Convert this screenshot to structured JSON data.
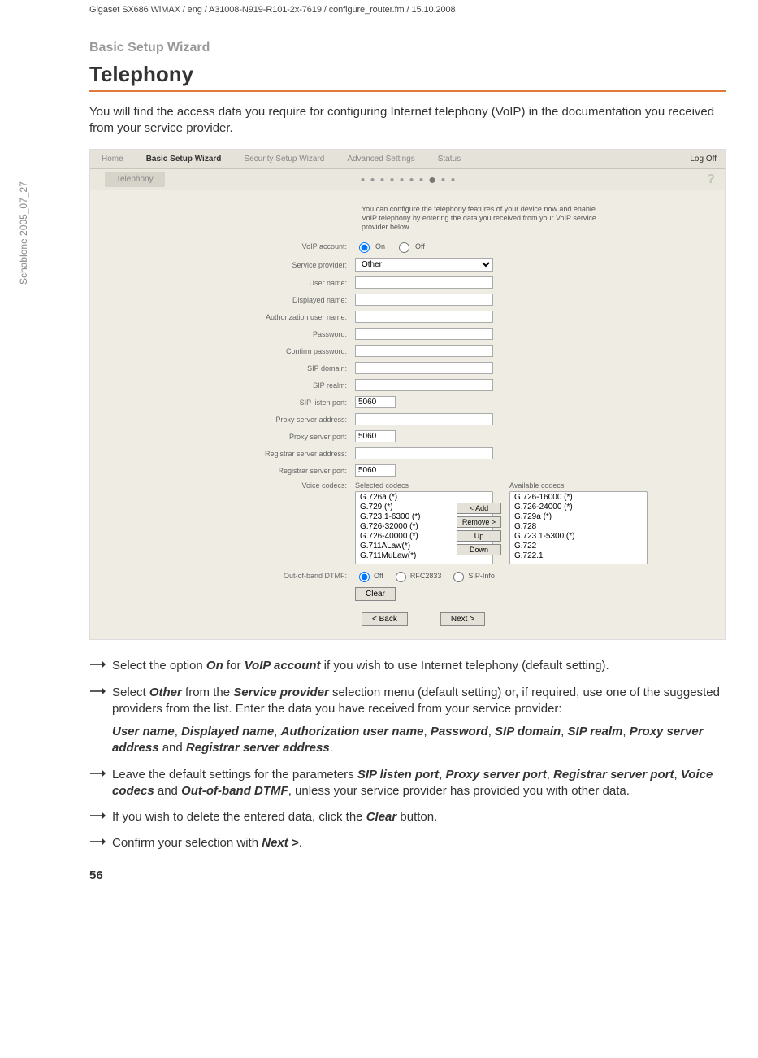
{
  "header_line": "Gigaset SX686 WiMAX / eng / A31008-N919-R101-2x-7619 / configure_router.fm / 15.10.2008",
  "side_label": "Schablone 2005_07_27",
  "section_label": "Basic Setup Wizard",
  "title": "Telephony",
  "intro": "You will find the access data you require for configuring Internet telephony (VoIP) in the documentation you received from your service provider.",
  "page_number": "56",
  "screenshot": {
    "tabs": {
      "home": "Home",
      "basic": "Basic Setup Wizard",
      "security": "Security Setup Wizard",
      "advanced": "Advanced Settings",
      "status": "Status"
    },
    "logoff": "Log Off",
    "subtab": "Telephony",
    "help_icon": "?",
    "desc": "You can configure the telephony features of your device now and enable VoIP telephony by entering the data you received from your VoIP service provider below.",
    "labels": {
      "voip_account": "VoIP account:",
      "service_provider": "Service provider:",
      "user_name": "User name:",
      "displayed_name": "Displayed name:",
      "auth_user": "Authorization user name:",
      "password": "Password:",
      "confirm_pw": "Confirm password:",
      "sip_domain": "SIP domain:",
      "sip_realm": "SIP realm:",
      "sip_listen_port": "SIP listen port:",
      "proxy_addr": "Proxy server address:",
      "proxy_port": "Proxy server port:",
      "reg_addr": "Registrar server address:",
      "reg_port": "Registrar server port:",
      "voice_codecs": "Voice codecs:",
      "oobdtmf": "Out-of-band DTMF:"
    },
    "radio": {
      "on": "On",
      "off": "Off"
    },
    "service_provider_value": "Other",
    "sip_listen_port_value": "5060",
    "proxy_port_value": "5060",
    "reg_port_value": "5060",
    "codecs": {
      "selected_title": "Selected codecs",
      "available_title": "Available codecs",
      "selected": [
        "G.726a (*)",
        "G.729 (*)",
        "G.723.1-6300 (*)",
        "G.726-32000 (*)",
        "G.726-40000 (*)",
        "G.711ALaw(*)",
        "G.711MuLaw(*)"
      ],
      "available": [
        "G.726-16000 (*)",
        "G.726-24000 (*)",
        "G.729a (*)",
        "G.728",
        "G.723.1-5300 (*)",
        "G.722",
        "G.722.1"
      ],
      "btn_add": "< Add",
      "btn_remove": "Remove >",
      "btn_up": "Up",
      "btn_down": "Down"
    },
    "dtmf": {
      "off": "Off",
      "rfc": "RFC2833",
      "sip": "SIP-Info"
    },
    "btn_clear": "Clear",
    "btn_back": "< Back",
    "btn_next": "Next >"
  },
  "bullets": {
    "b1_pre": "Select the option ",
    "b1_on": "On",
    "b1_mid": " for ",
    "b1_voip": "VoIP account",
    "b1_post": " if you wish to use Internet telephony (default setting).",
    "b2_pre": "Select ",
    "b2_other": "Other",
    "b2_mid1": " from the ",
    "b2_sp": "Service provider",
    "b2_post": " selection menu (default setting) or, if required, use one of the suggested providers from the list. Enter the data you have received from your service provider:",
    "b2_sub_un": "User name",
    "b2_sub_dn": "Displayed name",
    "b2_sub_au": "Authorization user name",
    "b2_sub_pw": "Password",
    "b2_sub_sd": "SIP domain",
    "b2_sub_sr": "SIP realm",
    "b2_sub_pa": "Proxy server address",
    "b2_sub_ra": "Registrar server address",
    "b2_and": " and ",
    "b2_comma": ", ",
    "b2_period": ".",
    "b3_pre": "Leave the default settings for the parameters ",
    "b3_slp": "SIP listen port",
    "b3_psp": "Proxy server port",
    "b3_rsp": "Registrar server port",
    "b3_vc": "Voice codecs",
    "b3_dtmf": "Out-of-band DTMF",
    "b3_post": ", unless your service provider has provided you with other data.",
    "b4_pre": "If you wish to delete the entered data, click the ",
    "b4_clear": "Clear",
    "b4_post": " button.",
    "b5_pre": "Confirm your selection with ",
    "b5_next": "Next >",
    "b5_post": "."
  }
}
